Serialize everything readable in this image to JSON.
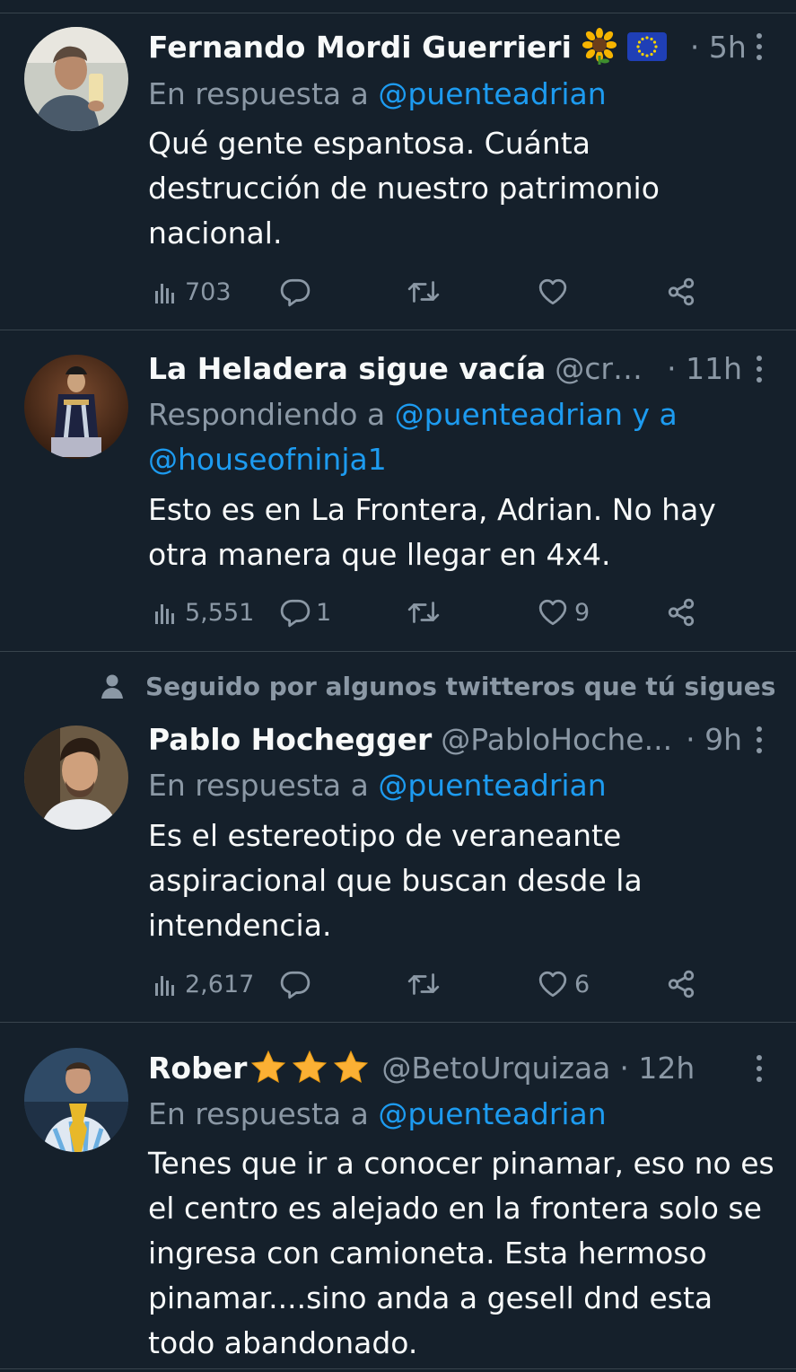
{
  "colors": {
    "background": "#15202b",
    "text": "#f7f9f9",
    "muted": "#8b98a5",
    "link": "#1d9bf0",
    "divider": "#38444d"
  },
  "tweets": [
    {
      "display_name": "Fernando Mordi Guerrieri",
      "badges": [
        "sunflower-emoji",
        "eu-flag-emoji"
      ],
      "handle": "",
      "time": "· 5h",
      "reply_prefix": "En respuesta a ",
      "reply_mention": "@puenteadrian",
      "text": "Qué gente espantosa. Cuánta destrucción de nuestro patrimonio nacional.",
      "views": "703",
      "replies": "",
      "retweets": "",
      "likes": ""
    },
    {
      "display_name": "La Heladera sigue vacía",
      "handle": "@crpa...",
      "time": "· 11h",
      "reply_prefix": "Respondiendo a ",
      "reply_mention": "@puenteadrian y a @houseofninja1",
      "text": "Esto es en La Frontera, Adrian. No hay otra manera que llegar en 4x4.",
      "views": "5,551",
      "replies": "1",
      "retweets": "",
      "likes": "9"
    },
    {
      "social_context": "Seguido por algunos twitteros que tú sigues",
      "display_name": "Pablo Hochegger",
      "handle": "@PabloHoche...",
      "time": "· 9h",
      "reply_prefix": "En respuesta a ",
      "reply_mention": "@puenteadrian",
      "text": "Es el estereotipo de veraneante aspiracional que buscan desde la intendencia.",
      "views": "2,617",
      "replies": "",
      "retweets": "",
      "likes": "6"
    },
    {
      "display_name": "Rober",
      "badges": [
        "star-emoji",
        "star-emoji",
        "star-emoji"
      ],
      "handle": "@BetoUrquizaa",
      "time": "· 12h",
      "reply_prefix": "En respuesta a ",
      "reply_mention": "@puenteadrian",
      "text": "Tenes que ir a conocer pinamar, eso no es el centro es alejado en la frontera solo se ingresa con camioneta. Esta hermoso pinamar....sino anda a gesell dnd esta todo abandonado."
    }
  ],
  "icons": {
    "views": "bar-chart-icon",
    "reply": "reply-bubble-icon",
    "retweet": "retweet-icon",
    "like": "heart-icon",
    "share": "share-icon",
    "more": "more-options-icon",
    "person": "person-icon"
  }
}
